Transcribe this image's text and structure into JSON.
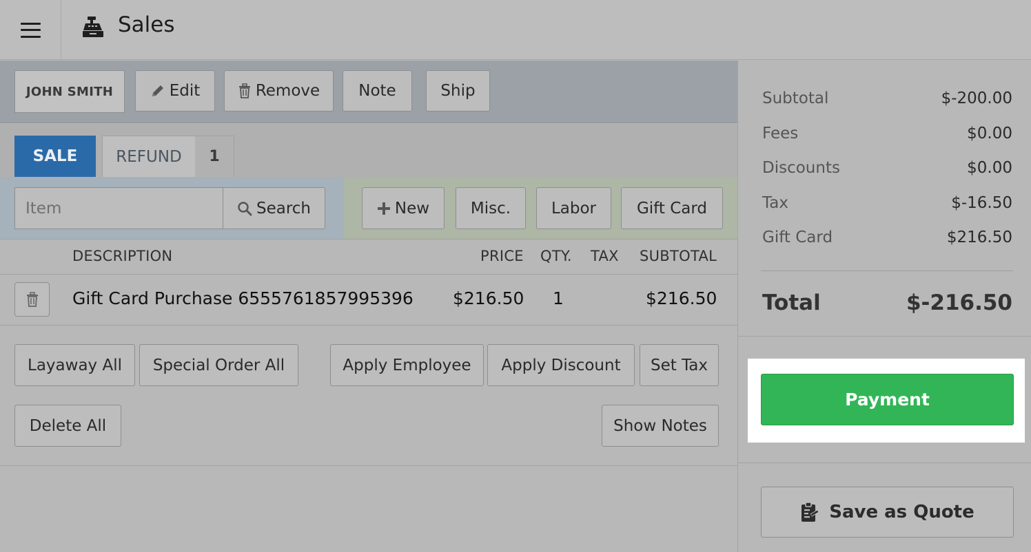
{
  "header": {
    "title": "Sales",
    "menu_icon": "hamburger-icon",
    "app_icon": "cash-register-icon"
  },
  "customer_bar": {
    "customer_name": "JOHN SMITH",
    "edit_label": "Edit",
    "remove_label": "Remove",
    "note_label": "Note",
    "ship_label": "Ship"
  },
  "tabs": {
    "sale_label": "SALE",
    "refund_label": "REFUND",
    "refund_count": "1"
  },
  "search": {
    "item_placeholder": "Item",
    "search_label": "Search"
  },
  "add_buttons": {
    "new_label": "New",
    "misc_label": "Misc.",
    "labor_label": "Labor",
    "gift_card_label": "Gift Card"
  },
  "table": {
    "headers": {
      "description": "DESCRIPTION",
      "price": "PRICE",
      "qty": "QTY.",
      "tax": "TAX",
      "subtotal": "SUBTOTAL"
    },
    "rows": [
      {
        "description": "Gift Card Purchase 6555761857995396",
        "price": "$216.50",
        "qty": "1",
        "tax": "",
        "subtotal": "$216.50"
      }
    ]
  },
  "actions": {
    "layaway_all": "Layaway All",
    "special_order_all": "Special Order All",
    "apply_employee": "Apply Employee",
    "apply_discount": "Apply Discount",
    "set_tax": "Set Tax",
    "delete_all": "Delete All",
    "show_notes": "Show Notes"
  },
  "summary": {
    "subtotal_label": "Subtotal",
    "subtotal_value": "$-200.00",
    "fees_label": "Fees",
    "fees_value": "$0.00",
    "discounts_label": "Discounts",
    "discounts_value": "$0.00",
    "tax_label": "Tax",
    "tax_value": "$-16.50",
    "gift_card_label": "Gift Card",
    "gift_card_value": "$216.50",
    "total_label": "Total",
    "total_value": "$-216.50"
  },
  "payment": {
    "payment_label": "Payment",
    "save_quote_label": "Save as Quote"
  },
  "colors": {
    "sale_tab": "#2b6aa8",
    "payment_button": "#32b556",
    "highlight": "#ffffff"
  }
}
